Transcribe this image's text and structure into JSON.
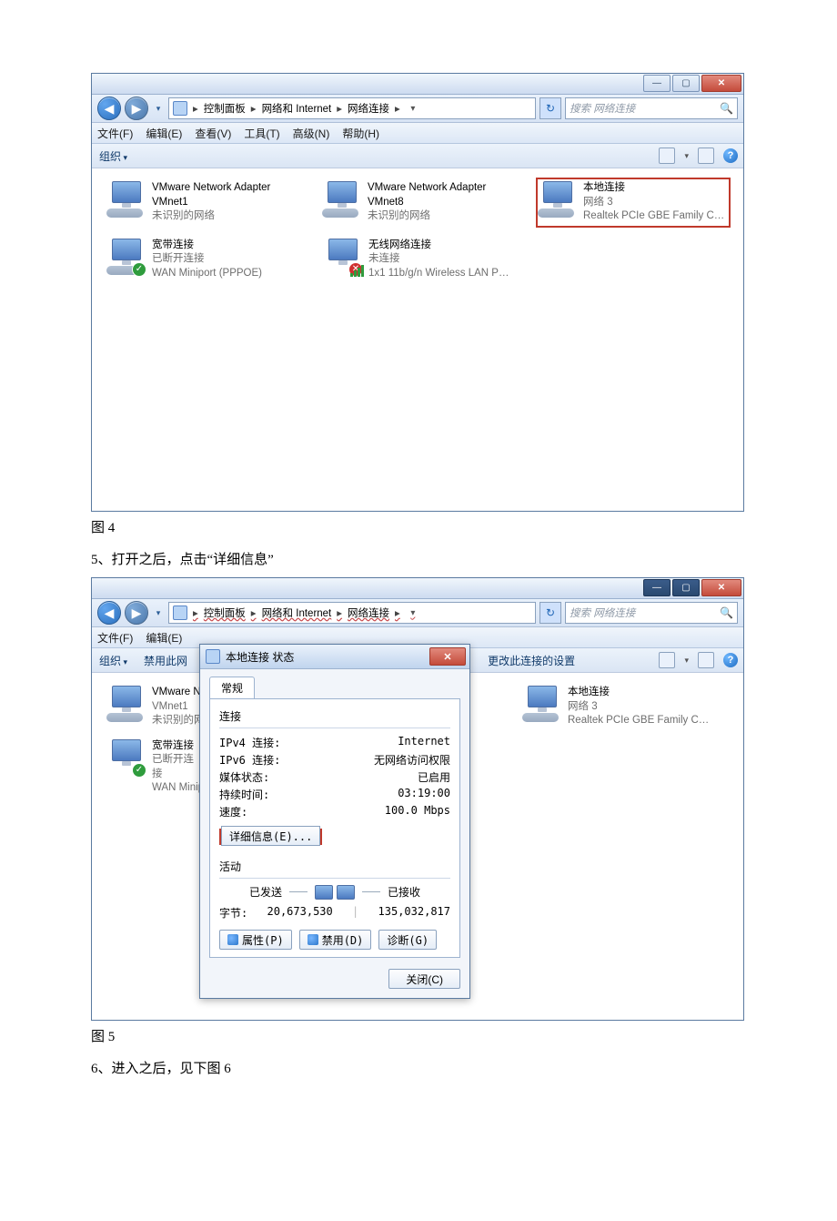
{
  "breadcrumbs": {
    "control_panel": "控制面板",
    "network_internet": "网络和 Internet",
    "network_connections": "网络连接"
  },
  "search_placeholder": "搜索 网络连接",
  "menus": {
    "file": "文件(F)",
    "edit": "编辑(E)",
    "view": "查看(V)",
    "tools": "工具(T)",
    "advanced": "高级(N)",
    "help": "帮助(H)"
  },
  "cmdbarA": {
    "organize": "组织"
  },
  "cmdbarB": {
    "organize": "组织",
    "disable": "禁用此网",
    "change_settings": "更改此连接的设置"
  },
  "connections": {
    "vmnet1": {
      "name": "VMware Network Adapter VMnet1",
      "status": "未识别的网络"
    },
    "vmnet8": {
      "name": "VMware Network Adapter VMnet8",
      "status": "未识别的网络"
    },
    "lan": {
      "name": "本地连接",
      "status": "网络 3",
      "device": "Realtek PCIe GBE Family Contr..."
    },
    "broadband": {
      "name": "宽带连接",
      "status": "已断开连接",
      "device": "WAN Miniport (PPPOE)"
    },
    "wlan": {
      "name": "无线网络连接",
      "status": "未连接",
      "device": "1x1 11b/g/n Wireless LAN PCI..."
    },
    "vmnet1_cut": {
      "name": "VMware N",
      "sub": "VMnet1",
      "status": "未识别的网"
    },
    "bb_cut": {
      "name": "宽带连接",
      "status": "已断开连接",
      "device": "WAN Minip"
    }
  },
  "fig4_caption": "图 4",
  "step5_text": "5、打开之后，点击“详细信息”",
  "fig5_caption": "图 5",
  "step6_text": "6、进入之后，见下图 6",
  "dialog": {
    "title": "本地连接 状态",
    "tab": "常规",
    "group_connect": "连接",
    "ipv4_label": "IPv4 连接:",
    "ipv4_value": "Internet",
    "ipv6_label": "IPv6 连接:",
    "ipv6_value": "无网络访问权限",
    "media_label": "媒体状态:",
    "media_value": "已启用",
    "duration_label": "持续时间:",
    "duration_value": "03:19:00",
    "speed_label": "速度:",
    "speed_value": "100.0 Mbps",
    "details_btn": "详细信息(E)...",
    "group_activity": "活动",
    "sent_label": "已发送",
    "recv_label": "已接收",
    "bytes_label": "字节:",
    "sent_bytes": "20,673,530",
    "recv_bytes": "135,032,817",
    "properties_btn": "属性(P)",
    "disable_btn": "禁用(D)",
    "diagnose_btn": "诊断(G)",
    "close_btn": "关闭(C)"
  }
}
